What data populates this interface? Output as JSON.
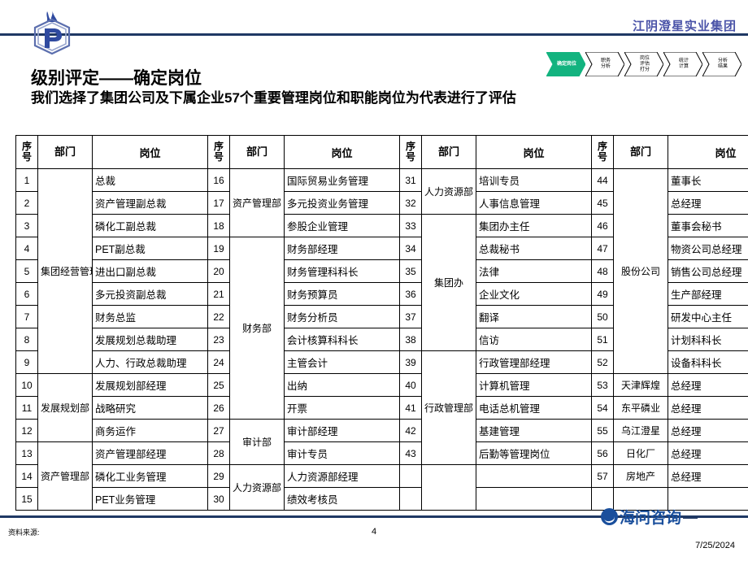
{
  "header": {
    "company_name": "江阴澄星实业集团",
    "logo_icon": "hexagon-p-flame-logo"
  },
  "process_flow": {
    "steps": [
      {
        "label_lines": [
          "确定岗位"
        ],
        "active": true
      },
      {
        "label_lines": [
          "职务",
          "分析"
        ],
        "active": false
      },
      {
        "label_lines": [
          "岗位",
          "评估",
          "打分"
        ],
        "active": false
      },
      {
        "label_lines": [
          "统计",
          "计算"
        ],
        "active": false
      },
      {
        "label_lines": [
          "分析",
          "结果"
        ],
        "active": false
      }
    ],
    "active_color": "#13b37f"
  },
  "title": {
    "main": "级别评定——确定岗位",
    "sub": "我们选择了集团公司及下属企业57个重要管理岗位和职能岗位为代表进行了评估"
  },
  "table": {
    "headers": [
      "序号",
      "部门",
      "岗位",
      "序号",
      "部门",
      "岗位",
      "序号",
      "部门",
      "岗位",
      "序号",
      "部门",
      "岗位"
    ],
    "blocks": [
      {
        "rows": [
          {
            "num": "1",
            "dept": "",
            "pos": "总裁"
          },
          {
            "num": "2",
            "dept": "",
            "pos": "资产管理副总裁"
          },
          {
            "num": "3",
            "dept": "",
            "pos": "磷化工副总裁"
          },
          {
            "num": "4",
            "dept": "集团经营管理委员会",
            "pos": "PET副总裁"
          },
          {
            "num": "5",
            "dept": "",
            "pos": "进出口副总裁"
          },
          {
            "num": "6",
            "dept": "",
            "pos": "多元投资副总裁"
          },
          {
            "num": "7",
            "dept": "",
            "pos": "财务总监"
          },
          {
            "num": "8",
            "dept": "",
            "pos": "发展规划总裁助理"
          },
          {
            "num": "9",
            "dept": "",
            "pos": "人力、行政总裁助理"
          },
          {
            "num": "10",
            "dept": "",
            "pos": "发展规划部经理"
          },
          {
            "num": "11",
            "dept": "发展规划部",
            "pos": "战略研究"
          },
          {
            "num": "12",
            "dept": "",
            "pos": "商务运作"
          },
          {
            "num": "13",
            "dept": "",
            "pos": "资产管理部经理"
          },
          {
            "num": "14",
            "dept": "资产管理部",
            "pos": "磷化工业务管理"
          },
          {
            "num": "15",
            "dept": "",
            "pos": "PET业务管理"
          }
        ],
        "dept_spans": [
          {
            "label": "集团经营管理委员会",
            "start": 1,
            "span": 9
          },
          {
            "label": "发展规划部",
            "start": 10,
            "span": 3
          },
          {
            "label": "资产管理部",
            "start": 13,
            "span": 3
          }
        ]
      },
      {
        "rows": [
          {
            "num": "16",
            "pos": "国际贸易业务管理"
          },
          {
            "num": "17",
            "pos": "多元投资业务管理"
          },
          {
            "num": "18",
            "pos": "参股企业管理"
          },
          {
            "num": "19",
            "pos": "财务部经理"
          },
          {
            "num": "20",
            "pos": "财务管理科科长"
          },
          {
            "num": "21",
            "pos": "财务预算员"
          },
          {
            "num": "22",
            "pos": "财务分析员"
          },
          {
            "num": "23",
            "pos": "会计核算科科长"
          },
          {
            "num": "24",
            "pos": "主管会计"
          },
          {
            "num": "25",
            "pos": "出纳"
          },
          {
            "num": "26",
            "pos": "开票"
          },
          {
            "num": "27",
            "pos": "审计部经理"
          },
          {
            "num": "28",
            "pos": "审计专员"
          },
          {
            "num": "29",
            "pos": "人力资源部经理"
          },
          {
            "num": "30",
            "pos": "绩效考核员"
          }
        ],
        "dept_spans": [
          {
            "label": "资产管理部",
            "start": 1,
            "span": 3
          },
          {
            "label": "财务部",
            "start": 4,
            "span": 8
          },
          {
            "label": "审计部",
            "start": 12,
            "span": 2
          },
          {
            "label": "人力资源部",
            "start": 14,
            "span": 2
          }
        ]
      },
      {
        "rows": [
          {
            "num": "31",
            "pos": "培训专员"
          },
          {
            "num": "32",
            "pos": "人事信息管理"
          },
          {
            "num": "33",
            "pos": "集团办主任"
          },
          {
            "num": "34",
            "pos": "总裁秘书"
          },
          {
            "num": "35",
            "pos": "法律"
          },
          {
            "num": "36",
            "pos": "企业文化"
          },
          {
            "num": "37",
            "pos": "翻译"
          },
          {
            "num": "38",
            "pos": "信访"
          },
          {
            "num": "39",
            "pos": "行政管理部经理"
          },
          {
            "num": "40",
            "pos": "计算机管理"
          },
          {
            "num": "41",
            "pos": "电话总机管理"
          },
          {
            "num": "42",
            "pos": "基建管理"
          },
          {
            "num": "43",
            "pos": "后勤等管理岗位"
          },
          {
            "num": "",
            "pos": ""
          },
          {
            "num": "",
            "pos": ""
          }
        ],
        "dept_spans": [
          {
            "label": "人力资源部",
            "start": 1,
            "span": 2
          },
          {
            "label": "集团办",
            "start": 3,
            "span": 6
          },
          {
            "label": "行政管理部",
            "start": 9,
            "span": 5
          },
          {
            "label": "",
            "start": 14,
            "span": 2
          }
        ]
      },
      {
        "rows": [
          {
            "num": "44",
            "dept": "",
            "pos": "董事长"
          },
          {
            "num": "45",
            "dept": "",
            "pos": "总经理"
          },
          {
            "num": "46",
            "dept": "",
            "pos": "董事会秘书"
          },
          {
            "num": "47",
            "dept": "",
            "pos": "物资公司总经理"
          },
          {
            "num": "48",
            "dept": "股份公司",
            "pos": "销售公司总经理"
          },
          {
            "num": "49",
            "dept": "",
            "pos": "生产部经理"
          },
          {
            "num": "50",
            "dept": "",
            "pos": "研发中心主任"
          },
          {
            "num": "51",
            "dept": "",
            "pos": "计划科科长"
          },
          {
            "num": "52",
            "dept": "",
            "pos": "设备科科长"
          },
          {
            "num": "53",
            "dept": "天津辉煌",
            "pos": "总经理"
          },
          {
            "num": "54",
            "dept": "东平磷业",
            "pos": "总经理"
          },
          {
            "num": "55",
            "dept": "乌江澄星",
            "pos": "总经理"
          },
          {
            "num": "56",
            "dept": "日化厂",
            "pos": "总经理"
          },
          {
            "num": "57",
            "dept": "房地产",
            "pos": "总经理"
          },
          {
            "num": "",
            "dept": "",
            "pos": ""
          }
        ],
        "dept_spans": [
          {
            "label": "股份公司",
            "start": 1,
            "span": 9
          },
          {
            "label": "天津辉煌",
            "start": 10,
            "span": 1
          },
          {
            "label": "东平磷业",
            "start": 11,
            "span": 1
          },
          {
            "label": "乌江澄星",
            "start": 12,
            "span": 1
          },
          {
            "label": "日化厂",
            "start": 13,
            "span": 1
          },
          {
            "label": "房地产",
            "start": 14,
            "span": 1
          },
          {
            "label": "",
            "start": 15,
            "span": 1
          }
        ]
      }
    ]
  },
  "footer": {
    "source_label": "资料来源:",
    "page_number": "4",
    "logo_text": "海问咨询",
    "date": "7/25/2024"
  }
}
